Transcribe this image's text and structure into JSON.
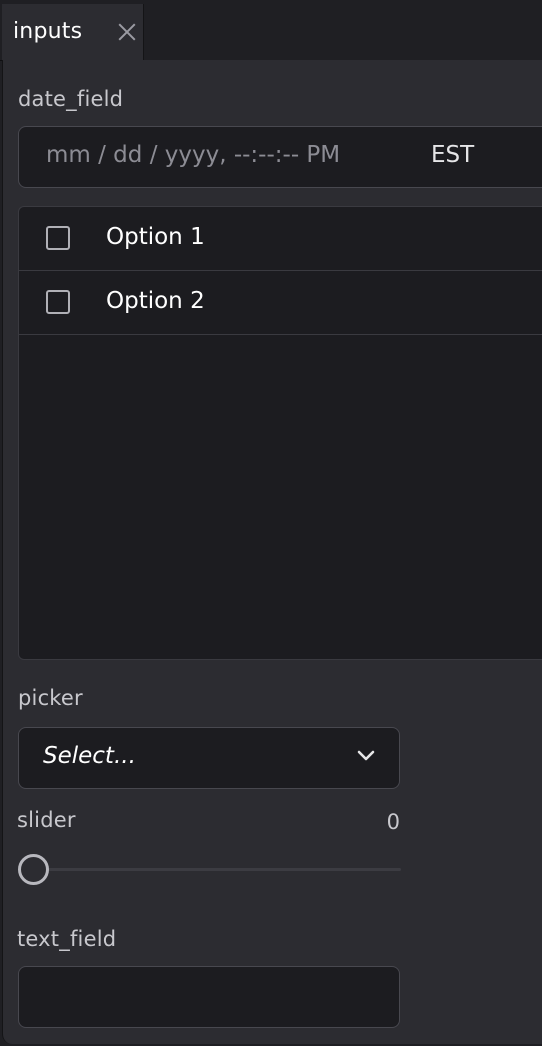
{
  "tab": {
    "label": "inputs",
    "close_icon": "close-icon"
  },
  "date_field": {
    "label": "date_field",
    "placeholder": "mm / dd / yyyy,  --:--:--  PM",
    "timezone": "EST"
  },
  "options": [
    {
      "label": "Option 1",
      "checked": false
    },
    {
      "label": "Option 2",
      "checked": false
    }
  ],
  "picker": {
    "label": "picker",
    "value": "Select...",
    "icon": "chevron-down-icon"
  },
  "slider": {
    "label": "slider",
    "value": "0"
  },
  "text_field": {
    "label": "text_field",
    "value": ""
  },
  "colors": {
    "panel": "#2c2c31",
    "field": "#1c1c20",
    "border": "#48484f",
    "text": "#ffffff",
    "muted": "#c8c8cd"
  }
}
